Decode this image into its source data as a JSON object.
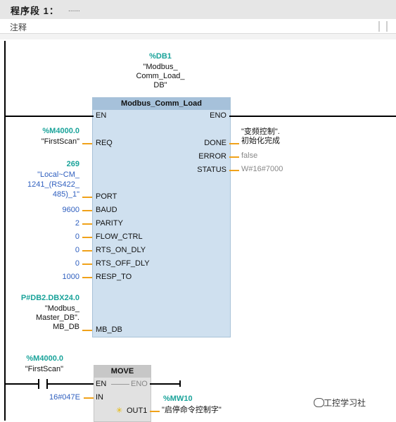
{
  "header": {
    "segment_title": "程序段 1：",
    "segment_dots": "......",
    "comment_label": "注释"
  },
  "block1": {
    "instance_db": "%DB1",
    "instance_db_name": [
      "\"Modbus_",
      "Comm_Load_",
      "DB\""
    ],
    "title": "Modbus_Comm_Load",
    "inputs": {
      "en": "EN",
      "req": "REQ",
      "port": "PORT",
      "baud": "BAUD",
      "parity": "PARITY",
      "flow_ctrl": "FLOW_CTRL",
      "rts_on_dly": "RTS_ON_DLY",
      "rts_off_dly": "RTS_OFF_DLY",
      "resp_to": "RESP_TO",
      "mb_db": "MB_DB"
    },
    "outputs": {
      "eno": "ENO",
      "done": "DONE",
      "error": "ERROR",
      "status": "STATUS"
    },
    "req_addr": "%M4000.0",
    "req_name": "\"FirstScan\"",
    "port_value": "269",
    "port_name": [
      "\"Local~CM_",
      "1241_(RS422_",
      "485)_1\""
    ],
    "baud_value": "9600",
    "parity_value": "2",
    "flow_ctrl_value": "0",
    "rts_on_value": "0",
    "rts_off_value": "0",
    "resp_to_value": "1000",
    "mb_db_addr": "P#DB2.DBX24.0",
    "mb_db_name": [
      "\"Modbus_",
      "Master_DB\".",
      "MB_DB"
    ],
    "done_name": [
      "\"变频控制\".",
      "初始化完成"
    ],
    "error_value": "false",
    "status_value": "W#16#7000"
  },
  "block2": {
    "contact_addr": "%M4000.0",
    "contact_name": "\"FirstScan\"",
    "title": "MOVE",
    "en": "EN",
    "eno": "ENO",
    "in": "IN",
    "out1": "OUT1",
    "in_value": "16#047E",
    "out_addr": "%MW10",
    "out_name": "\"启停命令控制字\""
  },
  "watermark": "工控学习社"
}
